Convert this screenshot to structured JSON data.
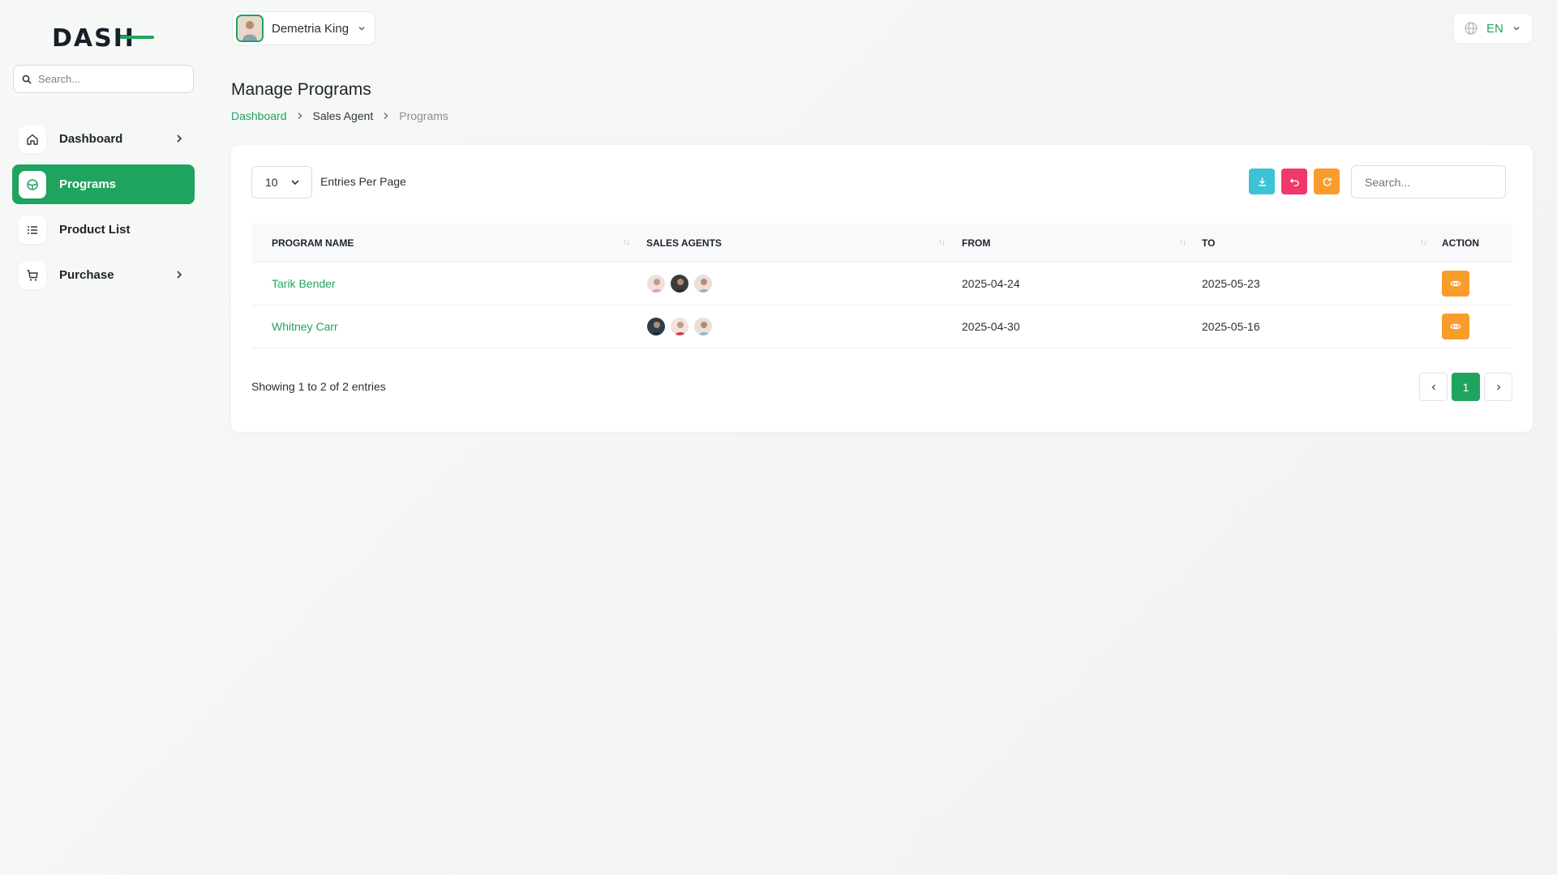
{
  "app": {
    "logo_text": "DASH"
  },
  "sidebar": {
    "search_placeholder": "Search...",
    "items": [
      {
        "label": "Dashboard",
        "icon": "home-icon",
        "has_chevron": true,
        "active": false
      },
      {
        "label": "Programs",
        "icon": "programs-icon",
        "has_chevron": false,
        "active": true
      },
      {
        "label": "Product List",
        "icon": "list-icon",
        "has_chevron": false,
        "active": false
      },
      {
        "label": "Purchase",
        "icon": "cart-icon",
        "has_chevron": true,
        "active": false
      }
    ]
  },
  "topbar": {
    "user_name": "Demetria King",
    "language": "EN"
  },
  "page": {
    "title": "Manage Programs",
    "breadcrumb": [
      "Dashboard",
      "Sales Agent",
      "Programs"
    ]
  },
  "table_controls": {
    "entries_value": "10",
    "entries_label": "Entries Per Page",
    "search_placeholder": "Search...",
    "tool_colors": {
      "download": "#3ec2d6",
      "reset": "#f0386b",
      "refresh": "#fa9c2c"
    }
  },
  "table": {
    "columns": [
      "Program Name",
      "Sales Agents",
      "From",
      "To",
      "Action"
    ],
    "rows": [
      {
        "program_name": "Tarik Bender",
        "from": "2025-04-24",
        "to": "2025-05-23"
      },
      {
        "program_name": "Whitney Carr",
        "from": "2025-04-30",
        "to": "2025-05-16"
      }
    ]
  },
  "footer": {
    "showing": "Showing 1 to 2 of 2 entries",
    "current_page": "1"
  },
  "colors": {
    "accent": "#1fa45f",
    "action": "#fa9c2c"
  }
}
